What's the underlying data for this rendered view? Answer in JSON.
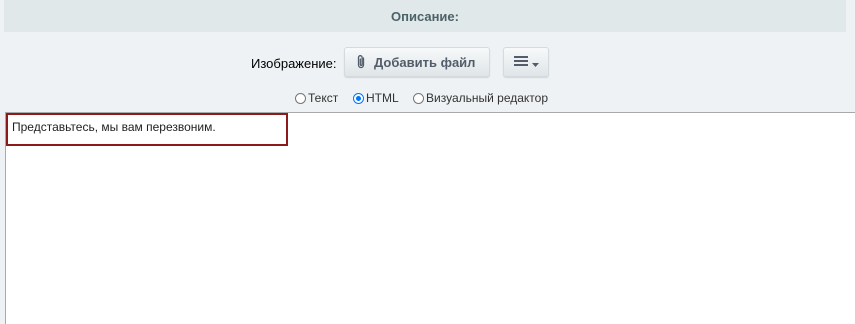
{
  "section": {
    "title": "Описание:"
  },
  "image_row": {
    "label": "Изображение:",
    "add_file_label": "Добавить файл",
    "menu_icon": "hamburger-dropdown-icon"
  },
  "mode_options": [
    {
      "label": "Текст",
      "checked": false
    },
    {
      "label": "HTML",
      "checked": true
    },
    {
      "label": "Визуальный редактор",
      "checked": false
    }
  ],
  "editor": {
    "content": "Представьтесь, мы вам перезвоним."
  },
  "colors": {
    "header_bg": "#e0e8ea",
    "header_text": "#4b6267",
    "radio_accent": "#0075ff",
    "highlight_border": "#8b1a1a"
  }
}
